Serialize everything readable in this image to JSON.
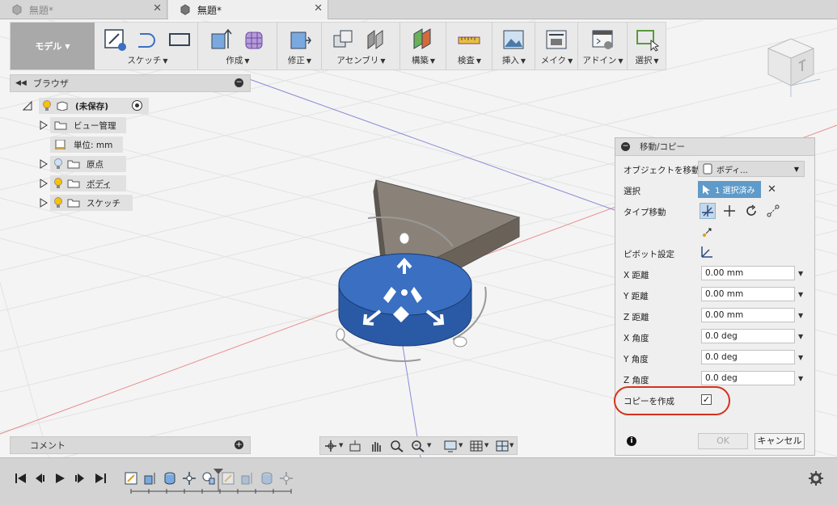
{
  "tabs": [
    {
      "title": "無題*",
      "active": false
    },
    {
      "title": "無題*",
      "active": true
    }
  ],
  "toolbar": {
    "workspace": "モデル",
    "groups": [
      {
        "label": "スケッチ"
      },
      {
        "label": "作成"
      },
      {
        "label": "修正"
      },
      {
        "label": "アセンブリ"
      },
      {
        "label": "構築"
      },
      {
        "label": "検査"
      },
      {
        "label": "挿入"
      },
      {
        "label": "メイク"
      },
      {
        "label": "アドイン"
      },
      {
        "label": "選択"
      }
    ]
  },
  "browser": {
    "title": "ブラウザ",
    "items": [
      {
        "label": "(未保存)"
      },
      {
        "label": "ビュー管理"
      },
      {
        "label": "単位: mm"
      },
      {
        "label": "原点"
      },
      {
        "label": "ボディ"
      },
      {
        "label": "スケッチ"
      }
    ]
  },
  "comments": {
    "title": "コメント"
  },
  "panel": {
    "title": "移動/コピー",
    "object_label": "オブジェクトを移動",
    "object_value": "ボディ...",
    "selection_label": "選択",
    "selection_value": "1 選択済み",
    "type_label": "タイプ移動",
    "pivot_label": "ピボット設定",
    "x_dist_label": "X 距離",
    "x_dist": "0.00 mm",
    "y_dist_label": "Y 距離",
    "y_dist": "0.00 mm",
    "z_dist_label": "Z 距離",
    "z_dist": "0.00 mm",
    "x_angle_label": "X 角度",
    "x_angle": "0.0 deg",
    "y_angle_label": "Y 角度",
    "y_angle": "0.0 deg",
    "z_angle_label": "Z 角度",
    "z_angle": "0.0 deg",
    "copy_label": "コピーを作成",
    "copy_checked": "✓",
    "ok": "OK",
    "cancel": "キャンセル"
  },
  "colors": {
    "accent": "#5f9ac8",
    "highlight": "#d4321c",
    "body_blue": "#2f66b8"
  }
}
